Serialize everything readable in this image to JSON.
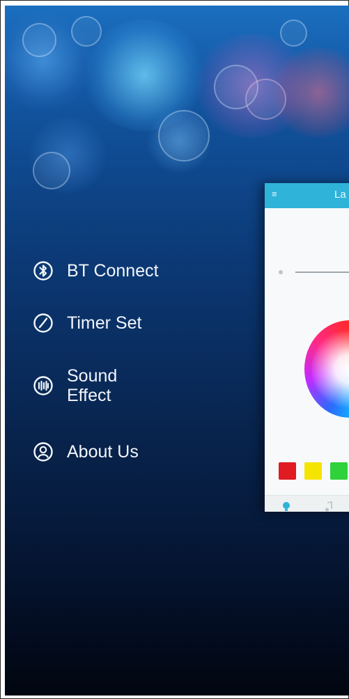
{
  "menu": {
    "items": [
      {
        "label": "BT Connect",
        "icon": "bluetooth-icon"
      },
      {
        "label": "Timer Set",
        "icon": "clock-icon"
      },
      {
        "label": "Sound\nEffect",
        "icon": "sound-wave-icon"
      },
      {
        "label": "About Us",
        "icon": "user-icon"
      }
    ]
  },
  "preview": {
    "title": "La",
    "back_label": "≡",
    "topbar_color": "#2fb3d9",
    "swatches": [
      {
        "color": "#e01b22"
      },
      {
        "color": "#f5e400"
      },
      {
        "color": "#2fd23a"
      }
    ],
    "tabs": [
      {
        "icon": "bulb-icon"
      },
      {
        "icon": "music-note-icon"
      }
    ]
  },
  "colors": {
    "accent": "#2fb3d9",
    "menu_text": "#f2f6fb"
  }
}
